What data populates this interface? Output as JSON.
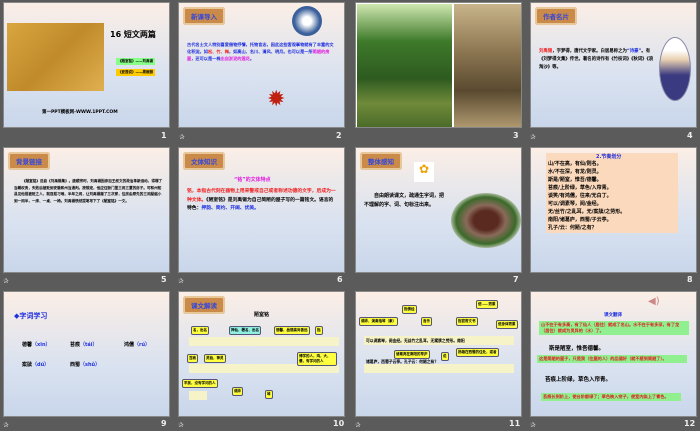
{
  "slides": [
    {
      "number": "1",
      "title": "16 短文两篇",
      "sub1": "《陋室铭》——刘禹锡",
      "sub2": "《爱莲说》——周敦颐",
      "footer": "第一PPT模板网-WWW.1PPT.COM"
    },
    {
      "number": "2",
      "tag": "新课导入",
      "text_a": "古代名士文人特别喜爱借物抒情，托物言志，因此这些客观事物就有了丰富的文化积淀。如",
      "text_b": "松、竹、梅",
      "text_c": "，如高山、名川、清风、明月。也可以是一所",
      "text_d": "简陋的房屋",
      "text_e": "，还可以是一株",
      "text_f": "出自淤泥的莲花",
      "text_g": "。"
    },
    {
      "number": "3"
    },
    {
      "number": "4",
      "tag": "作者名片",
      "name": "刘禹锡",
      "text_a": "，字梦得，唐代文学家。白居易称之为",
      "text_b": "“诗豪”",
      "text_c": "。有《刘梦得文集》传世。著名的诗作有《竹枝词》《秋词》《浪淘沙》等。"
    },
    {
      "number": "5",
      "tag": "背景链接",
      "text": "《陋室铭》选自《刘禹锡集》。唐顺宗时，刘禹锡因参加王叔文的政治革新运动，得罪了当朝权贵，失败后被贬到安徽和州当通判。按规定，他应住衙门里三间三厦的房子。可和州知县见他是被贬之人，就百般刁难，半年之间，让刘禹锡搬了三次家，住房由原先的三间屋缩小到一间半，一床、一桌、一椅。刘禹锡愤然提笔写下了《陋室铭》一文。"
    },
    {
      "number": "6",
      "tag": "文体知识",
      "heading": "“铭”的文体特点",
      "text_a": "铭，本指古代刻在器物上用来警戒自己或者称述功德的文字，后成为一种文体。",
      "text_b": "《陋室铭》是刘禹锡为自己简陋的屋子写的一篇铭文。语言的特色：",
      "text_c": "押韵、简约、开阔、优美。"
    },
    {
      "number": "7",
      "tag": "整体感知",
      "text": "自由朗读课文，疏通生字词，把不理解的字、词、句标注出来。"
    },
    {
      "number": "8",
      "heading": "2.节奏划分",
      "lines": [
        "山/不在高，有仙/则名。",
        "水/不在深，有龙/则灵。",
        "斯是/陋室，惟吾/德馨。",
        "苔痕/上阶绿，草色/入帘青。",
        "谈笑/有鸿儒，往来/无白丁。",
        "可以/调素琴，阅/金经。",
        "无/丝竹/之乱耳，无/案牍/之劳形。",
        "南阳/诸葛庐，西蜀/子云亭。",
        "孔子/云：何陋/之有？"
      ]
    },
    {
      "number": "9",
      "heading": "◆字词学习",
      "words": [
        {
          "w": "德馨",
          "p": "（xīn）"
        },
        {
          "w": "苔痕",
          "p": "（tái）"
        },
        {
          "w": "鸿儒",
          "p": "（rú）"
        },
        {
          "w": "案牍",
          "p": "（dú）"
        },
        {
          "w": "西蜀",
          "p": "（shǔ）"
        }
      ]
    },
    {
      "number": "10",
      "tag": "课文解读",
      "heading": "陋室铭",
      "bubbles": [
        "名，出名",
        "神仙、著名、出名",
        "灵验，神灵",
        "指",
        "苔痕",
        "德馨，品德高尚香远",
        "博学的人，鸿，大，儒，有学问的人",
        "平民，没有学问的人",
        "调弄",
        "琴"
      ]
    },
    {
      "number": "11",
      "line1": "可以调素琴，阅金经。无丝竹之乱耳，无案牍之劳形。南阳",
      "line2": "诸葛庐，西蜀子云亭。孔子云：何陋之有？",
      "bubbles": [
        "调弄，演奏指琴（素）",
        "指佛经",
        "音乐",
        "指官府文书",
        "使……劳累",
        "使身体劳累",
        "诸葛亮在南阳的草庐",
        "说",
        "扬雄在西蜀的住处，或者"
      ]
    },
    {
      "number": "12",
      "heading": "课文翻译",
      "tr1": "山不在于有多高，有了仙人（居住）就成了名山。水不在于有多深，有了龙（居住）就成为灵异的（水）了。",
      "orig2": "斯是陋室，惟吾德馨。",
      "tr2": "这是简陋的屋子，只是我（住屋的人）的品德好（就不感到简陋了）。",
      "orig3": "苔痕上阶绿，草色入帘青。",
      "tr3": "苔痕长到阶上，使台阶都绿了；草色映入帘子，使室内染上了青色。"
    }
  ]
}
